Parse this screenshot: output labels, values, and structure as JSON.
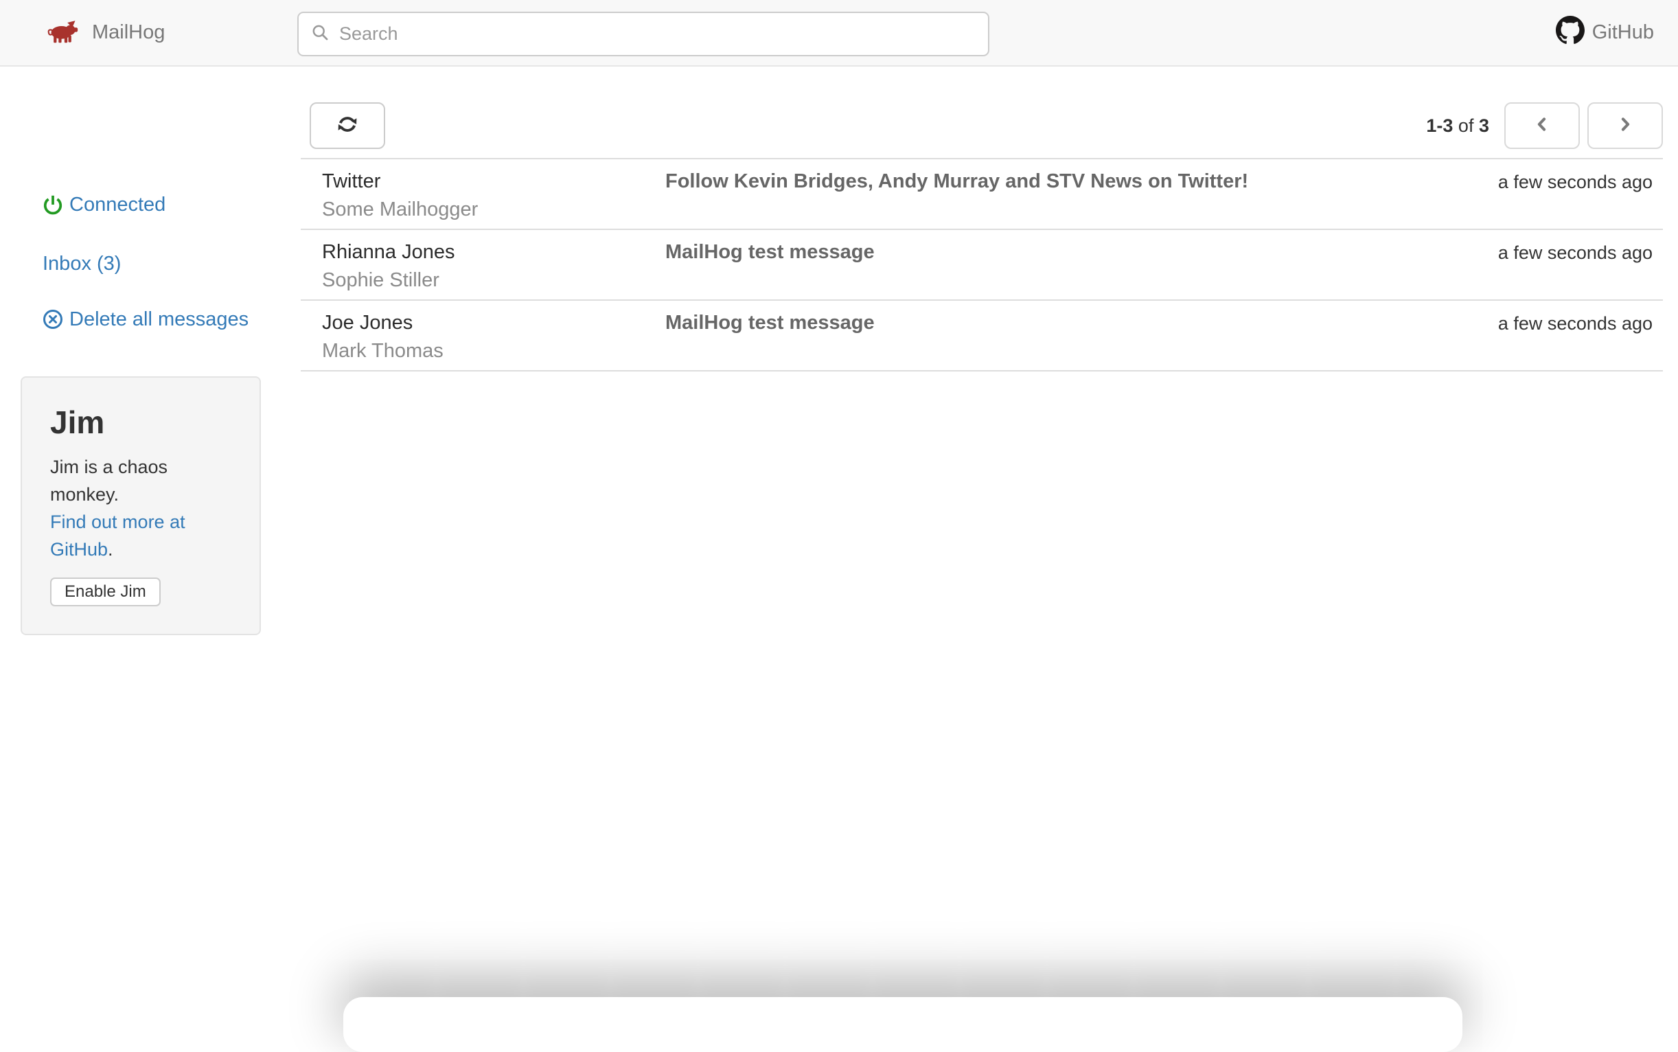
{
  "navbar": {
    "brand": "MailHog",
    "search": {
      "placeholder": "Search"
    },
    "github_label": "GitHub"
  },
  "sidebar": {
    "connected_label": "Connected",
    "inbox_label": "Inbox (3)",
    "delete_all_label": "Delete all messages",
    "jim": {
      "title": "Jim",
      "description": "Jim is a chaos monkey.",
      "link_text": "Find out more at GitHub",
      "link_suffix": ".",
      "button_label": "Enable Jim"
    }
  },
  "toolbar": {
    "pagination": {
      "range": "1-3",
      "of_word": "of",
      "total": "3"
    }
  },
  "messages": [
    {
      "from": "Twitter",
      "recipient": "Some Mailhogger",
      "subject": "Follow Kevin Bridges, Andy Murray and STV News on Twitter!",
      "time": "a few seconds ago"
    },
    {
      "from": "Rhianna Jones",
      "recipient": "Sophie Stiller",
      "subject": "MailHog test message",
      "time": "a few seconds ago"
    },
    {
      "from": "Joe Jones",
      "recipient": "Mark Thomas",
      "subject": "MailHog test message",
      "time": "a few seconds ago"
    }
  ],
  "icons": {
    "brand": "pig-icon",
    "search": "search-icon",
    "github": "github-icon",
    "connected": "power-icon",
    "delete_all": "circle-x-icon",
    "refresh": "refresh-icon",
    "prev": "chevron-left-icon",
    "next": "chevron-right-icon"
  },
  "colors": {
    "link_blue": "#337ab7",
    "connected_green": "#229a22",
    "brand_red": "#a8322d",
    "navbar_bg": "#f8f8f8",
    "navbar_text": "#777777",
    "divider": "#dddddd",
    "subject_text": "#666666",
    "recipient_text": "#8a8a8a",
    "sender_text": "#2b2b2b"
  }
}
